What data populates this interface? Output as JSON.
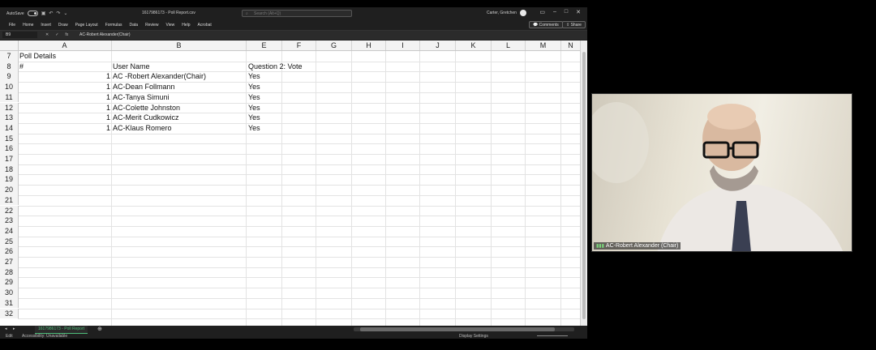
{
  "excel": {
    "autosave": "AutoSave",
    "doc_title": "1617986173 - Poll Report.csv",
    "search_placeholder": "Search (Alt+Q)",
    "user": "Carter, Gretchen",
    "tabs": [
      "File",
      "Home",
      "Insert",
      "Draw",
      "Page Layout",
      "Formulas",
      "Data",
      "Review",
      "View",
      "Help",
      "Acrobat"
    ],
    "comments": "Comments",
    "share": "Share",
    "name_box": "B9",
    "formula_value": "AC-Robert Alexander(Chair)",
    "columns": [
      "A",
      "B",
      "E",
      "F",
      "G",
      "H",
      "I",
      "J",
      "K",
      "L",
      "M",
      "N"
    ],
    "row_numbers": [
      "7",
      "8",
      "9",
      "10",
      "11",
      "12",
      "13",
      "14",
      "15",
      "16",
      "17",
      "18",
      "19",
      "20",
      "21",
      "22",
      "23",
      "24",
      "25",
      "26",
      "27",
      "28",
      "29",
      "30",
      "31",
      "32"
    ],
    "poll_title": "Poll Details",
    "headers": {
      "num": "#",
      "user": "User Name",
      "vote": "Question 2: Vote"
    },
    "records": [
      {
        "num": "1",
        "user": "AC -Robert Alexander(Chair)",
        "vote": "Yes"
      },
      {
        "num": "1",
        "user": "AC-Dean Follmann",
        "vote": "Yes"
      },
      {
        "num": "1",
        "user": "AC-Tanya Simuni",
        "vote": "Yes"
      },
      {
        "num": "1",
        "user": "AC-Colette Johnston",
        "vote": "Yes"
      },
      {
        "num": "1",
        "user": "AC-Merit Cudkowicz",
        "vote": "Yes"
      },
      {
        "num": "1",
        "user": "AC-Klaus Romero",
        "vote": "Yes"
      }
    ],
    "sheet_tab": "1617986173 - Poll Report",
    "status_left": "Edit",
    "accessibility": "Accessibility: Unavailable",
    "display_settings": "Display Settings"
  },
  "video": {
    "participant": "AC-Robert Alexander (Chair)"
  }
}
